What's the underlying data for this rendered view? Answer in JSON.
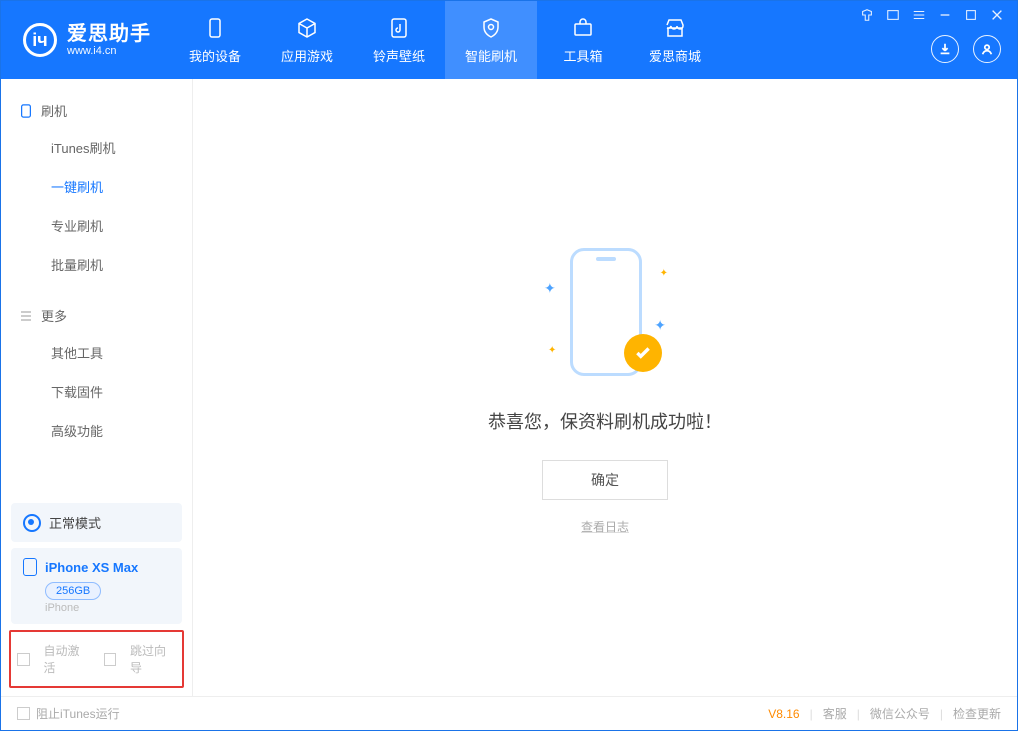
{
  "app": {
    "name_cn": "爱思助手",
    "name_en": "www.i4.cn"
  },
  "tabs": [
    {
      "label": "我的设备",
      "icon": "device"
    },
    {
      "label": "应用游戏",
      "icon": "cube"
    },
    {
      "label": "铃声壁纸",
      "icon": "music"
    },
    {
      "label": "智能刷机",
      "icon": "shield",
      "active": true
    },
    {
      "label": "工具箱",
      "icon": "toolbox"
    },
    {
      "label": "爱思商城",
      "icon": "store"
    }
  ],
  "window_controls": [
    "shirt",
    "skin",
    "menu",
    "min",
    "max",
    "close"
  ],
  "header_buttons": {
    "download": "download-icon",
    "user": "user-icon"
  },
  "sidebar": {
    "groups": [
      {
        "title": "刷机",
        "icon": "device-icon",
        "items": [
          {
            "label": "iTunes刷机"
          },
          {
            "label": "一键刷机",
            "active": true
          },
          {
            "label": "专业刷机"
          },
          {
            "label": "批量刷机"
          }
        ]
      },
      {
        "title": "更多",
        "icon": "list-icon",
        "items": [
          {
            "label": "其他工具"
          },
          {
            "label": "下载固件"
          },
          {
            "label": "高级功能"
          }
        ]
      }
    ],
    "mode": "正常模式",
    "device": {
      "name": "iPhone XS Max",
      "capacity": "256GB",
      "type": "iPhone"
    },
    "checkboxes": {
      "auto_activate": "自动激活",
      "skip_guide": "跳过向导"
    }
  },
  "main": {
    "success_text": "恭喜您，保资料刷机成功啦！",
    "ok_button": "确定",
    "view_log": "查看日志"
  },
  "footer": {
    "block_itunes": "阻止iTunes运行",
    "version": "V8.16",
    "links": [
      "客服",
      "微信公众号",
      "检查更新"
    ]
  }
}
